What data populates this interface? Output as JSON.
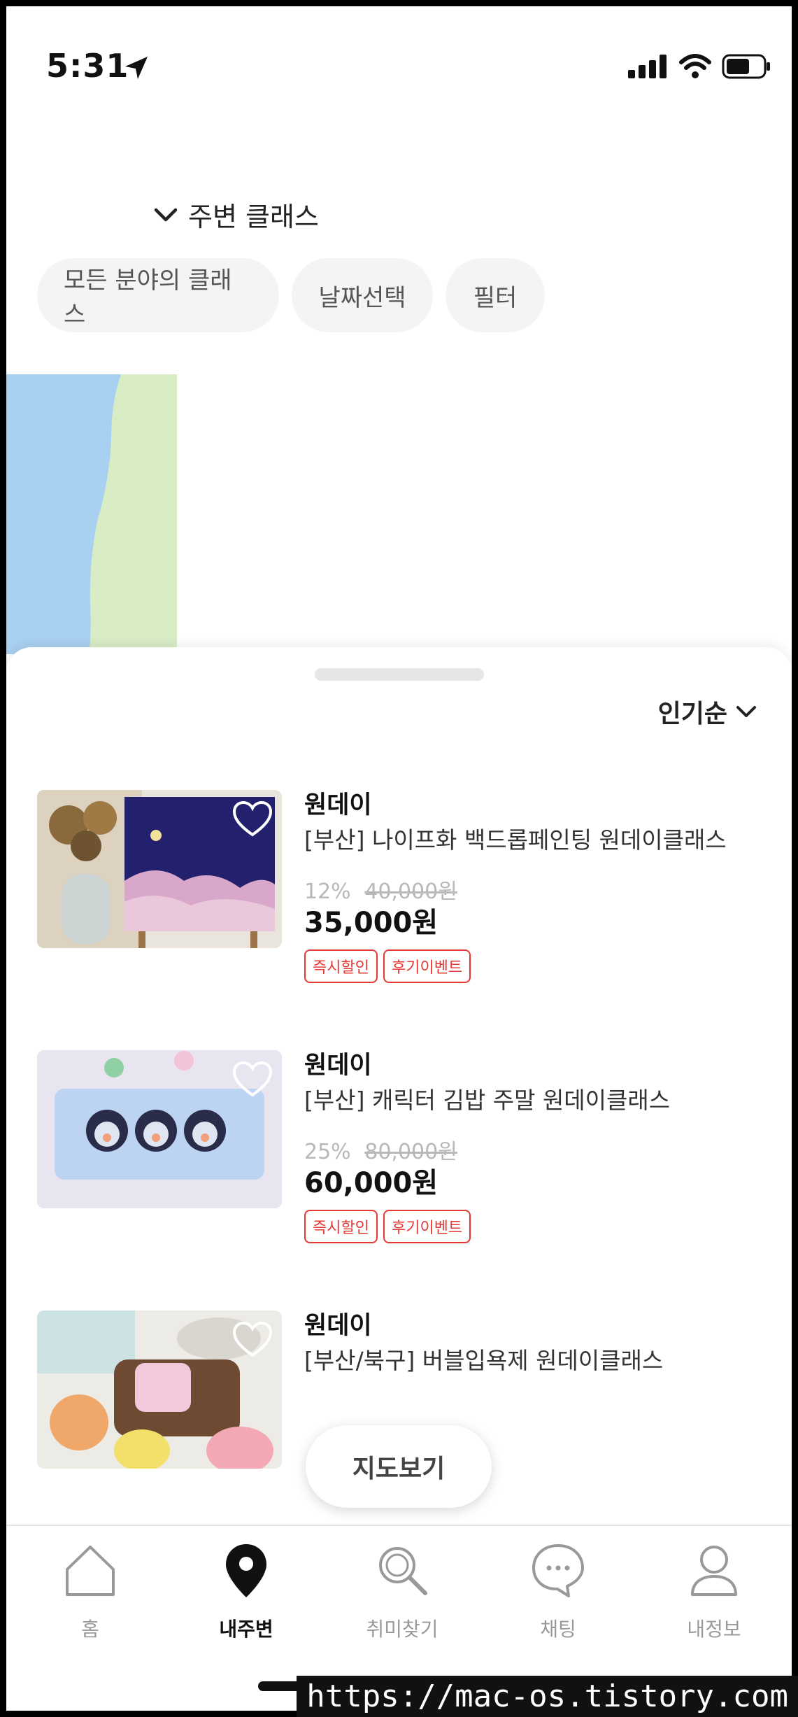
{
  "status_bar": {
    "time": "5:31"
  },
  "header": {
    "location_label": "주변 클래스"
  },
  "filters": [
    {
      "label": "모든 분야의 클래스"
    },
    {
      "label": "날짜선택"
    },
    {
      "label": "필터"
    }
  ],
  "sheet": {
    "sort_label": "인기순"
  },
  "classes": [
    {
      "category": "원데이",
      "title": "[부산] 나이프화 백드롭페인팅 원데이클래스",
      "discount_rate": "12%",
      "original_price": "40,000원",
      "price": "35,000원",
      "badges": [
        "즉시할인",
        "후기이벤트"
      ]
    },
    {
      "category": "원데이",
      "title": "[부산] 캐릭터 김밥 주말 원데이클래스",
      "discount_rate": "25%",
      "original_price": "80,000원",
      "price": "60,000원",
      "badges": [
        "즉시할인",
        "후기이벤트"
      ]
    },
    {
      "category": "원데이",
      "title": "[부산/북구]  버블입욕제 원데이클래스"
    }
  ],
  "map_button_label": "지도보기",
  "tabs": [
    {
      "label": "홈",
      "icon": "home-icon"
    },
    {
      "label": "내주변",
      "icon": "location-pin-icon",
      "active": true
    },
    {
      "label": "취미찾기",
      "icon": "search-icon"
    },
    {
      "label": "채팅",
      "icon": "chat-icon"
    },
    {
      "label": "내정보",
      "icon": "person-icon"
    }
  ],
  "watermark": "https://mac-os.tistory.com",
  "colors": {
    "accent_badge": "#e53935",
    "map_water": "#a8d0f0",
    "map_land": "#d8ecc6"
  }
}
